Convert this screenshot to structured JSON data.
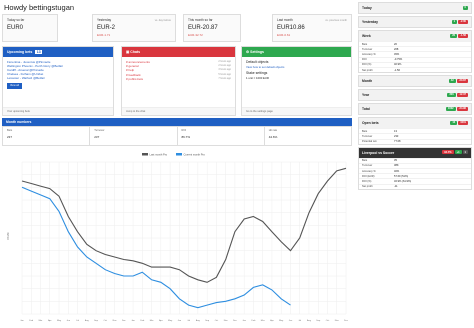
{
  "header": {
    "title": "Howdy bettingstugan"
  },
  "cards": [
    {
      "label": "Today so far",
      "value": "EUR0",
      "diff": ""
    },
    {
      "label": "Yesterday",
      "sub": "vs. day before",
      "value": "EUR-2",
      "diff": "EUR-1.71"
    },
    {
      "label": "This month so far",
      "sub": "vs. same day last month",
      "value": "EUR-20.87",
      "diff": "EUR-32.72"
    },
    {
      "label": "Last month",
      "sub": "vs. previous month",
      "value": "EUR10.86",
      "diff": "EUR-0.61"
    }
  ],
  "panels": {
    "upcoming": {
      "title": "Upcoming bets",
      "count": "13",
      "items": [
        "Fiorentina - Juventus @Pinnacle",
        "Wellington Phoenix - Perth Glory @Betfair",
        "Cardiff - Arsenal @Pinnacle",
        "Chelsea - Fulham @Unibet",
        "Leicester - Watford @Betfair"
      ],
      "button": "View all",
      "footer": "Your upcoming bets"
    },
    "chats": {
      "title": "Chats",
      "items": [
        {
          "text": "# announcements",
          "time": "2 hours ago"
        },
        {
          "text": "# general",
          "time": "2 hours ago"
        },
        {
          "text": "# help",
          "time": "3 hours ago"
        },
        {
          "text": "# feedback",
          "time": "5 hours ago"
        },
        {
          "text": "# public-bets",
          "time": "7 hours ago"
        }
      ],
      "footer": "Jump to the chat"
    },
    "settings": {
      "title": "Settings",
      "heading1": "Default objects",
      "link1": "View how to set default objects",
      "heading2": "Stake settings",
      "line2": "1 unit = 1000 EUR",
      "footer": "Go to the settings page"
    }
  },
  "month_numbers": {
    "title": "Month numbers",
    "stats": [
      {
        "label": "Bets",
        "value": "237"
      },
      {
        "label": "Turnover",
        "value": "237"
      },
      {
        "label": "ROI",
        "value": "86.7%"
      },
      {
        "label": "Hit rate",
        "value": "44.6%"
      }
    ]
  },
  "sidebar": [
    {
      "title": "Today",
      "badges": [
        {
          "t": "0",
          "c": "g"
        }
      ]
    },
    {
      "title": "Yesterday",
      "badges": [
        {
          "t": "1",
          "c": "g"
        },
        {
          "t": "-2.00",
          "c": "r"
        }
      ]
    },
    {
      "title": "Week",
      "badges": [
        {
          "t": "20",
          "c": "g"
        },
        {
          "t": "-1.56",
          "c": "r"
        }
      ],
      "rows": [
        [
          "Bets",
          "20"
        ],
        [
          "Turnover",
          "208"
        ],
        [
          "Accuracy %",
          "45%"
        ],
        [
          "ROI",
          "-0.75%"
        ],
        [
          "ROI (%)",
          "40.9%"
        ],
        [
          "Net profit",
          "-1.56"
        ]
      ]
    },
    {
      "title": "Month",
      "badges": [
        {
          "t": "42",
          "c": "g"
        },
        {
          "t": "-20.87",
          "c": "r"
        }
      ]
    },
    {
      "title": "Year",
      "badges": [
        {
          "t": "306",
          "c": "g"
        },
        {
          "t": "-12.37",
          "c": "r"
        }
      ]
    },
    {
      "title": "Total",
      "badges": [
        {
          "t": "1002",
          "c": "g"
        },
        {
          "t": "-24.96",
          "c": "r"
        }
      ]
    },
    {
      "title": "Open bets",
      "badges": [
        {
          "t": "13",
          "c": "g"
        },
        {
          "t": "1001",
          "c": "r"
        }
      ],
      "rows": [
        [
          "Bets",
          "13"
        ],
        [
          "Turnover",
          "233"
        ],
        [
          "Potential win",
          "77.08"
        ]
      ]
    },
    {
      "title": "Liverpool vs Soccer",
      "dark": true,
      "badges": [
        {
          "t": "94.7%",
          "c": "r"
        },
        {
          "t": "+1",
          "c": "g"
        },
        {
          "t": "1",
          "c": "k"
        }
      ],
      "rows": [
        [
          "Bets",
          "35"
        ],
        [
          "Turnover",
          "38K"
        ],
        [
          "Accuracy %",
          "46%"
        ],
        [
          "ROI (EUR)",
          "57.69 (51%)"
        ],
        [
          "ROI (%)",
          "32.9% (61.9%)"
        ],
        [
          "Net profit",
          "-11"
        ]
      ]
    }
  ],
  "chart_data": {
    "type": "line",
    "title": "",
    "x": [
      "Jan",
      "Feb",
      "Mar",
      "Apr",
      "May",
      "Jun",
      "Jul",
      "Aug",
      "Sep",
      "Oct",
      "Nov",
      "Dec",
      "Jan",
      "Feb",
      "Mar",
      "Apr",
      "May",
      "Jun",
      "Jul",
      "Aug",
      "Sep",
      "Oct",
      "Nov",
      "Dec",
      "Jan",
      "Feb",
      "Mar",
      "Apr",
      "May",
      "Jun",
      "Jul",
      "Aug",
      "Sep",
      "Oct",
      "Nov",
      "Dec"
    ],
    "series": [
      {
        "name": "Last month Pro",
        "color": "#555555",
        "values": [
          10,
          8,
          6,
          4,
          -2,
          -18,
          -30,
          -40,
          -45,
          -48,
          -50,
          -52,
          -53,
          -55,
          -58,
          -58,
          -58,
          -60,
          -65,
          -68,
          -70,
          -66,
          -52,
          -30,
          -20,
          -18,
          -22,
          -30,
          -38,
          -45,
          -35,
          -15,
          0,
          10,
          18,
          20
        ]
      },
      {
        "name": "Current month Pro",
        "color": "#2e8ee0",
        "values": [
          5,
          2,
          -1,
          -4,
          -14,
          -30,
          -42,
          -50,
          -55,
          -60,
          -63,
          -65,
          -65,
          -62,
          -68,
          -70,
          -75,
          -83,
          -88,
          -90,
          -88,
          -86,
          -85,
          -83,
          -80,
          -74,
          -72,
          -76,
          -83,
          -88,
          null,
          null,
          null,
          null,
          null,
          null
        ]
      }
    ],
    "grid": true,
    "ylabel": "Profit",
    "legend": "top"
  }
}
